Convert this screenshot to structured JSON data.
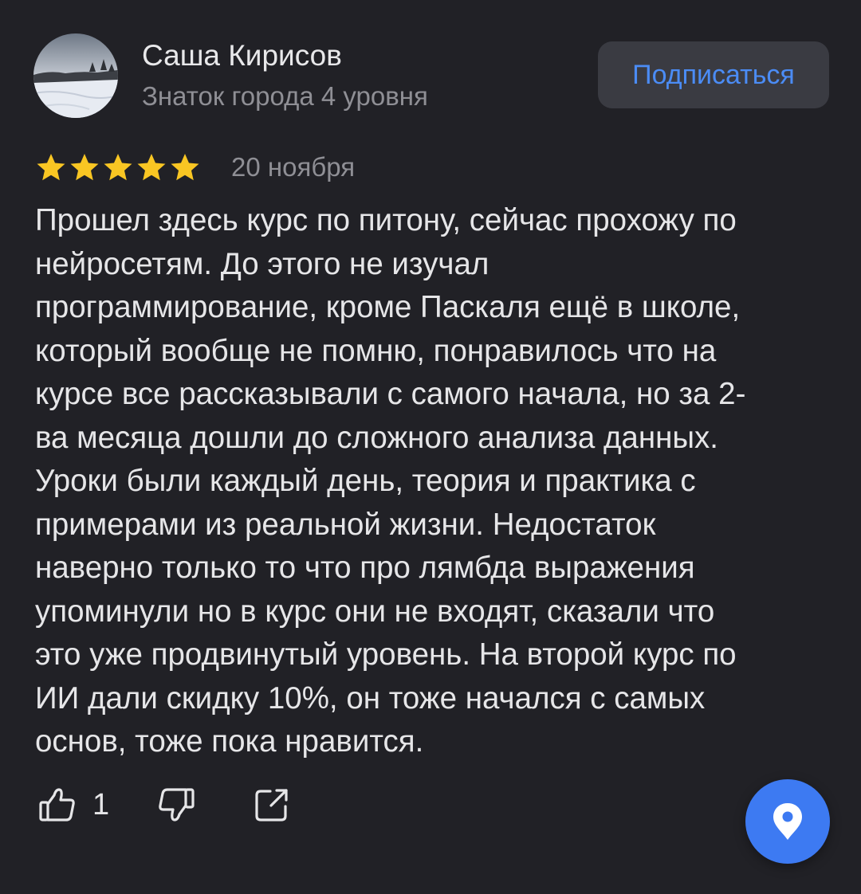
{
  "author": {
    "name": "Саша Кирисов",
    "level": "Знаток города 4 уровня",
    "avatar_icon": "winter-landscape-photo"
  },
  "subscribe_label": "Подписаться",
  "review": {
    "rating": 5,
    "rating_max": 5,
    "date": "20 ноября",
    "text": "Прошел здесь курс по питону, сейчас прохожу по\nнейросетям. До этого не изучал\nпрограммирование, кроме Паскаля ещё в школе,\nкоторый вообще не помню, понравилось что на\nкурсе все рассказывали с самого начала, но за 2-\nва месяца дошли до сложного анализа данных.\nУроки были каждый день, теория и практика с\nпримерами из реальной жизни. Недостаток\nнаверно только то что про лямбда выражения\nупоминули но в курс они не входят, сказали что\nэто уже продвинутый уровень. На второй курс по\nИИ дали скидку 10%, он тоже начался с самых\nоснов, тоже пока нравится."
  },
  "actions": {
    "like_count": "1",
    "like_icon": "thumbs-up-icon",
    "dislike_icon": "thumbs-down-icon",
    "share_icon": "share-icon"
  },
  "fab": {
    "icon": "map-pin-icon"
  },
  "colors": {
    "background": "#212126",
    "accent": "#4b8cf5",
    "star": "#f9c623",
    "fab": "#3d7af2"
  }
}
